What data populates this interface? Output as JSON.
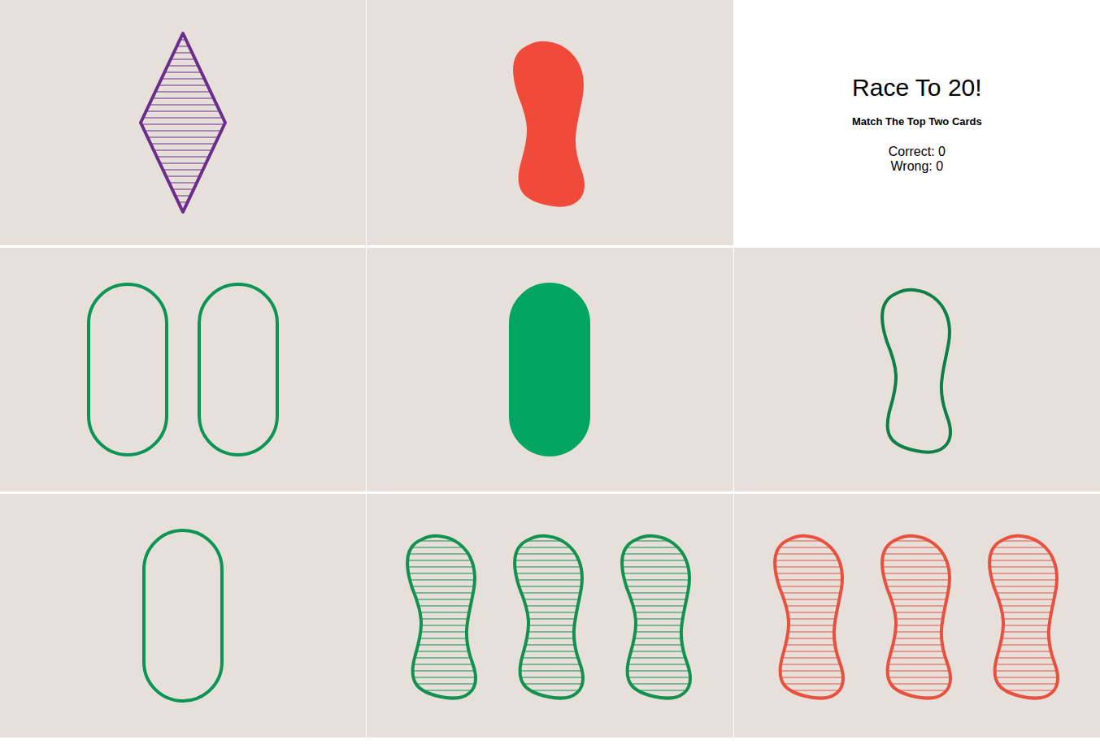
{
  "info": {
    "title": "Race To 20!",
    "subtitle": "Match The Top Two Cards",
    "correct": "Correct: 0",
    "wrong": "Wrong: 0"
  },
  "cards": [
    {
      "count": 1,
      "shape": "diamond",
      "shading": "striped",
      "color": "#6b2d8c"
    },
    {
      "count": 1,
      "shape": "squiggle",
      "shading": "solid",
      "color": "#ef4a3a"
    },
    {
      "count": 2,
      "shape": "oval",
      "shading": "open",
      "color": "#0a9455"
    },
    {
      "count": 1,
      "shape": "oval",
      "shading": "solid",
      "color": "#00a562"
    },
    {
      "count": 1,
      "shape": "squiggle",
      "shading": "open",
      "color": "#0c8048"
    },
    {
      "count": 1,
      "shape": "oval",
      "shading": "open",
      "color": "#0a9455"
    },
    {
      "count": 3,
      "shape": "squiggle",
      "shading": "striped",
      "color": "#12914f"
    },
    {
      "count": 3,
      "shape": "squiggle",
      "shading": "striped",
      "color": "#e8513f"
    }
  ]
}
